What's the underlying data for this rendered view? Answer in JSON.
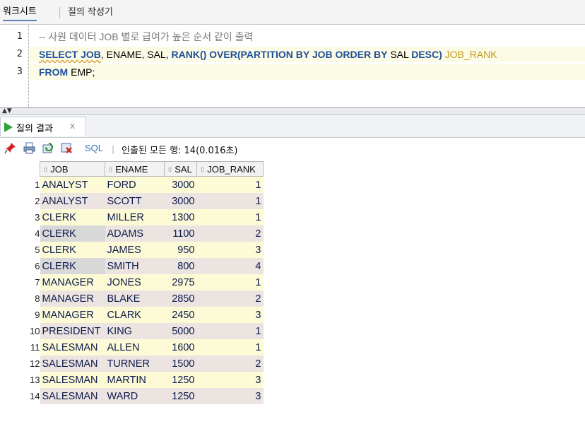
{
  "tabs": {
    "worksheet": "워크시트",
    "query_builder": "질의 작성기"
  },
  "editor": {
    "line_numbers": [
      "1",
      "2",
      "3"
    ],
    "line1": {
      "comment": "-- 사원 데이터 JOB 별로 급여가 높은 순서 같이 출력"
    },
    "line2": {
      "kw1": "SELECT JOB",
      "t1": ", ENAME, SAL, ",
      "kw2": "RANK() OVER(PARTITION BY JOB ORDER BY",
      "t2": " SAL ",
      "kw3": "DESC)",
      "alias": " JOB_RANK"
    },
    "line3": {
      "kw": "FROM",
      "t": " EMP;"
    }
  },
  "result_panel": {
    "tab_label": "질의 결과",
    "close": "x",
    "toolbar": {
      "sql_label": "SQL",
      "separator": "|",
      "status": "인출된 모든 행: 14(0.016초)",
      "icons": [
        "pin-icon",
        "print-icon",
        "refresh-icon",
        "export-icon"
      ]
    }
  },
  "grid": {
    "columns": [
      "JOB",
      "ENAME",
      "SAL",
      "JOB_RANK"
    ],
    "rows": [
      {
        "n": "1",
        "job": "ANALYST",
        "ename": "FORD",
        "sal": "3000",
        "rank": "1"
      },
      {
        "n": "2",
        "job": "ANALYST",
        "ename": "SCOTT",
        "sal": "3000",
        "rank": "1"
      },
      {
        "n": "3",
        "job": "CLERK",
        "ename": "MILLER",
        "sal": "1300",
        "rank": "1"
      },
      {
        "n": "4",
        "job": "CLERK",
        "ename": "ADAMS",
        "sal": "1100",
        "rank": "2"
      },
      {
        "n": "5",
        "job": "CLERK",
        "ename": "JAMES",
        "sal": "950",
        "rank": "3"
      },
      {
        "n": "6",
        "job": "CLERK",
        "ename": "SMITH",
        "sal": "800",
        "rank": "4"
      },
      {
        "n": "7",
        "job": "MANAGER",
        "ename": "JONES",
        "sal": "2975",
        "rank": "1"
      },
      {
        "n": "8",
        "job": "MANAGER",
        "ename": "BLAKE",
        "sal": "2850",
        "rank": "2"
      },
      {
        "n": "9",
        "job": "MANAGER",
        "ename": "CLARK",
        "sal": "2450",
        "rank": "3"
      },
      {
        "n": "10",
        "job": "PRESIDENT",
        "ename": "KING",
        "sal": "5000",
        "rank": "1"
      },
      {
        "n": "11",
        "job": "SALESMAN",
        "ename": "ALLEN",
        "sal": "1600",
        "rank": "1"
      },
      {
        "n": "12",
        "job": "SALESMAN",
        "ename": "TURNER",
        "sal": "1500",
        "rank": "2"
      },
      {
        "n": "13",
        "job": "SALESMAN",
        "ename": "MARTIN",
        "sal": "1250",
        "rank": "3"
      },
      {
        "n": "14",
        "job": "SALESMAN",
        "ename": "WARD",
        "sal": "1250",
        "rank": "3"
      }
    ]
  }
}
